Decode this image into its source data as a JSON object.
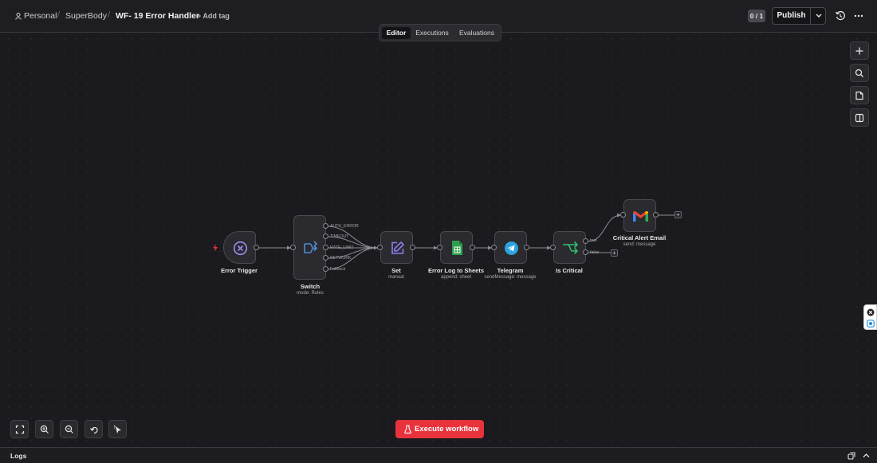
{
  "header": {
    "breadcrumb": {
      "personal": "Personal",
      "project": "SuperBody",
      "workflow": "WF- 19 Error Handler"
    },
    "separator": "/",
    "add_tag": "+ Add tag",
    "counter": "0 / 1",
    "publish_label": "Publish"
  },
  "tabs": [
    "Editor",
    "Executions",
    "Evaluations"
  ],
  "active_tab": "Editor",
  "nodes": {
    "error_trigger": {
      "label": "Error Trigger"
    },
    "switch": {
      "label": "Switch",
      "sub": "mode: Rules",
      "outputs": [
        "AUTH_ERROR",
        "TIMEOUT",
        "RATE_LIMIT",
        "NETWORK",
        "Fallback"
      ]
    },
    "set": {
      "label": "Set",
      "sub": "manual"
    },
    "sheets": {
      "label": "Error Log to Sheets",
      "sub": "append: sheet"
    },
    "telegram": {
      "label": "Telegram",
      "sub": "sendMessage: message"
    },
    "if": {
      "label": "Is Critical",
      "outputs": [
        "true",
        "false"
      ]
    },
    "email": {
      "label": "Critical Alert Email",
      "sub": "send: message"
    }
  },
  "execute_label": "Execute workflow",
  "logs_label": "Logs",
  "colors": {
    "accent_red": "#e8323c",
    "if_green": "#2fbf71",
    "switch_blue": "#4f8bd8",
    "set_purple": "#8a7ff0",
    "trigger_purple": "#9b8cf2",
    "sheets_green": "#2e9f4f",
    "telegram_blue": "#2aa3e0"
  },
  "icons": [
    "x-circle-icon",
    "switch-icon",
    "pencil-icon",
    "sheet-icon",
    "telegram-icon",
    "if-icon",
    "gmail-icon",
    "lightning-icon",
    "beaker-icon"
  ]
}
